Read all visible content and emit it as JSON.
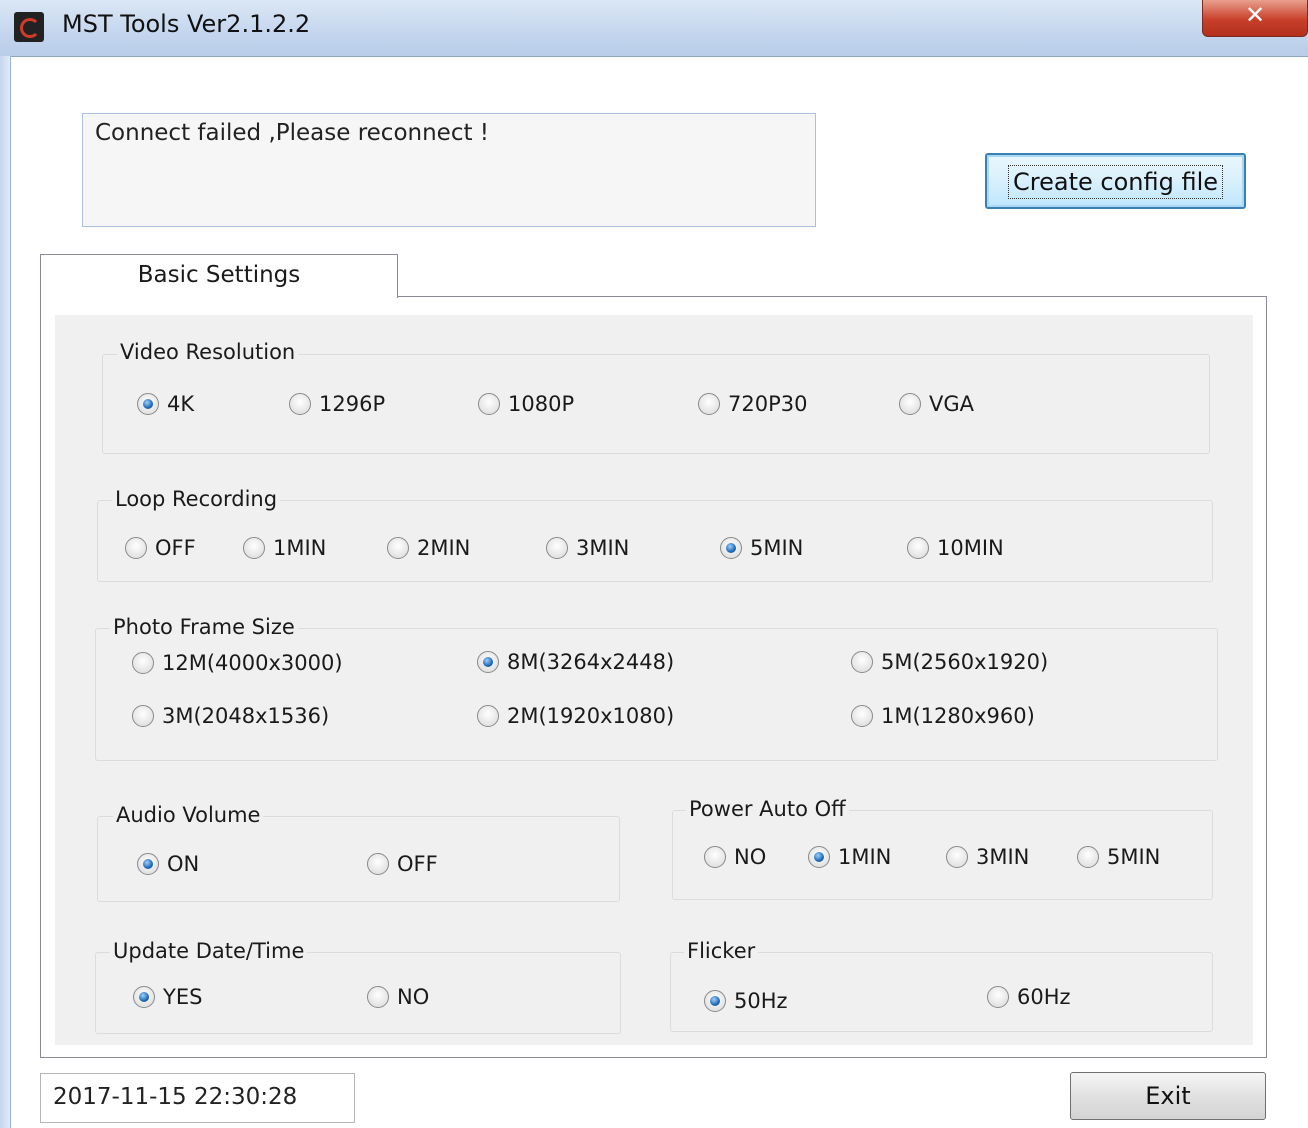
{
  "window": {
    "title": "MST Tools Ver2.1.2.2",
    "close_label": "✕"
  },
  "status": {
    "message": "Connect failed ,Please reconnect !"
  },
  "buttons": {
    "create_config": "Create config file",
    "exit": "Exit"
  },
  "tab": {
    "label": "Basic Settings"
  },
  "groups": {
    "video_resolution": {
      "title": "Video Resolution",
      "options": [
        "4K",
        "1296P",
        "1080P",
        "720P30",
        "VGA"
      ],
      "selected": "4K"
    },
    "loop_recording": {
      "title": "Loop Recording",
      "options": [
        "OFF",
        "1MIN",
        "2MIN",
        "3MIN",
        "5MIN",
        "10MIN"
      ],
      "selected": "5MIN"
    },
    "photo_frame_size": {
      "title": "Photo Frame Size",
      "options": [
        "12M(4000x3000)",
        "8M(3264x2448)",
        "5M(2560x1920)",
        "3M(2048x1536)",
        "2M(1920x1080)",
        "1M(1280x960)"
      ],
      "selected": "8M(3264x2448)"
    },
    "audio_volume": {
      "title": "Audio Volume",
      "options": [
        "ON",
        "OFF"
      ],
      "selected": "ON"
    },
    "power_auto_off": {
      "title": "Power Auto Off",
      "options": [
        "NO",
        "1MIN",
        "3MIN",
        "5MIN"
      ],
      "selected": "1MIN"
    },
    "update_datetime": {
      "title": "Update Date/Time",
      "options": [
        "YES",
        "NO"
      ],
      "selected": "YES"
    },
    "flicker": {
      "title": "Flicker",
      "options": [
        "50Hz",
        "60Hz"
      ],
      "selected": "50Hz"
    }
  },
  "datetime": "2017-11-15 22:30:28",
  "colors": {
    "titlebar": "#c4d6ee",
    "close": "#c8402a",
    "panel": "#f0f0f0",
    "accent": "#1e6ab5"
  }
}
